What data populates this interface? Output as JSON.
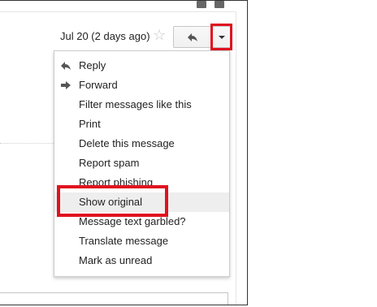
{
  "header": {
    "date": "Jul 20 (2 days ago)",
    "star_icon": "star-icon",
    "reply_icon": "reply-arrow-icon",
    "more_icon": "dropdown-caret-icon"
  },
  "menu": {
    "items": [
      {
        "label": "Reply",
        "icon": "reply-arrow-icon"
      },
      {
        "label": "Forward",
        "icon": "forward-arrow-icon"
      },
      {
        "label": "Filter messages like this"
      },
      {
        "label": "Print"
      },
      {
        "label": "Delete this message"
      },
      {
        "label": "Report spam"
      },
      {
        "label": "Report phishing"
      },
      {
        "label": "Show original"
      },
      {
        "label": "Message text garbled?"
      },
      {
        "label": "Translate message"
      },
      {
        "label": "Mark as unread"
      }
    ]
  },
  "highlights": {
    "color": "#e0121f"
  }
}
